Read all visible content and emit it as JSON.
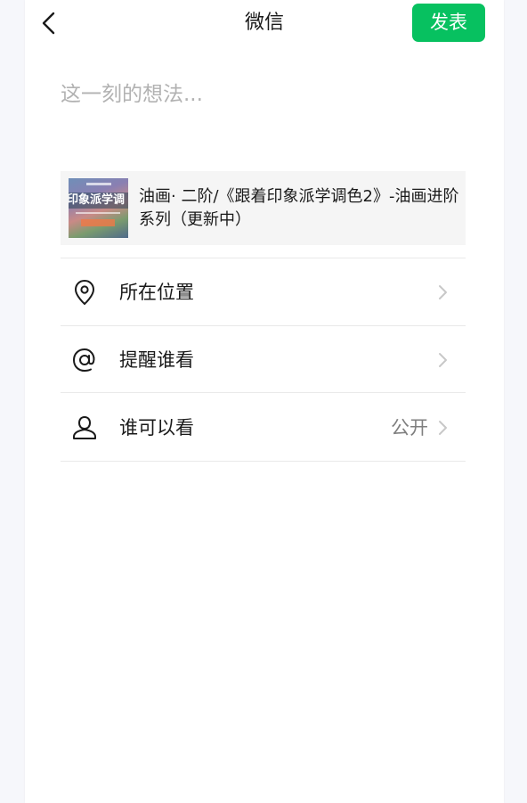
{
  "header": {
    "title": "微信",
    "publish_label": "发表",
    "back_icon": "chevron-left-icon"
  },
  "composer": {
    "placeholder": "这一刻的想法...",
    "value": ""
  },
  "share_card": {
    "title": "油画· 二阶/《跟着印象派学调色2》-油画进阶系列（更新中）",
    "thumbnail_text": "印象派学调"
  },
  "options": [
    {
      "label": "所在位置",
      "icon": "location-pin-icon",
      "value": ""
    },
    {
      "label": "提醒谁看",
      "icon": "at-sign-icon",
      "value": ""
    },
    {
      "label": "谁可以看",
      "icon": "person-icon",
      "value": "公开"
    }
  ],
  "colors": {
    "accent": "#07c160",
    "background": "#f6f7fb",
    "card_bg": "#f5f5f5",
    "placeholder": "#b2b2b2",
    "secondary_text": "#7f7f7f"
  }
}
